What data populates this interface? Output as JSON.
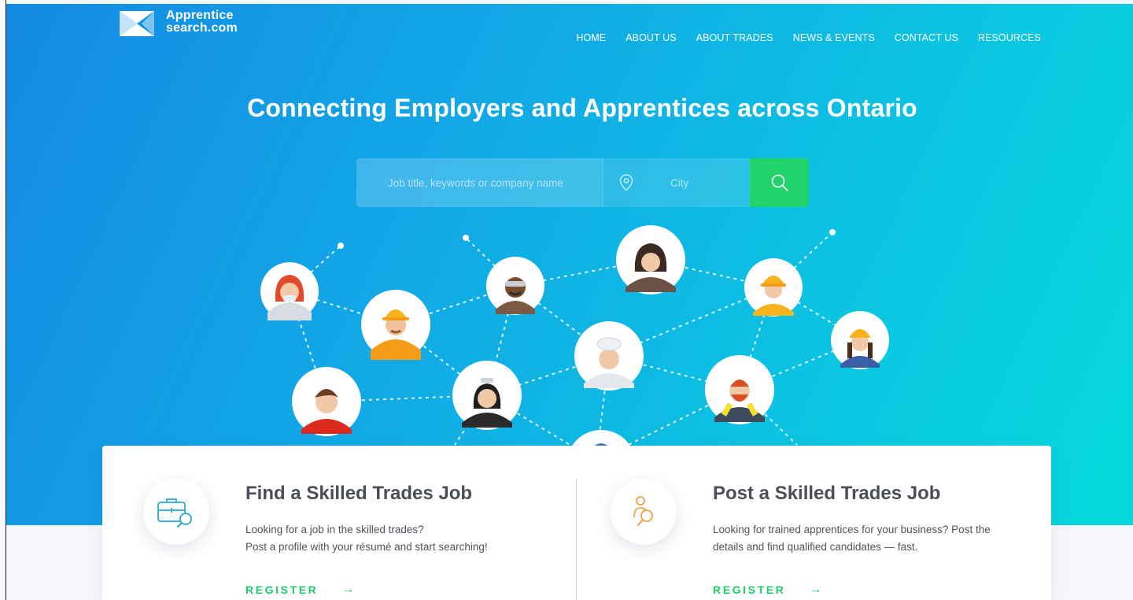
{
  "logo": {
    "line1": "Apprentice",
    "line2": "search.com"
  },
  "nav": {
    "home": "HOME",
    "about_us": "ABOUT US",
    "about_trades": "ABOUT TRADES",
    "news_events": "NEWS & EVENTS",
    "contact_us": "CONTACT US",
    "resources": "RESOURCES"
  },
  "hero": {
    "headline": "Connecting Employers and Apprentices across Ontario"
  },
  "search": {
    "keywords_placeholder": "Job title, keywords or company name",
    "city_placeholder": "City",
    "button_icon": "search-icon",
    "location_icon": "location-pin-icon"
  },
  "colors": {
    "accent_green": "#21d36b",
    "hero_blue": "#1489e3",
    "hero_cyan": "#06d9dc"
  },
  "find_job": {
    "title": "Find a Skilled Trades Job",
    "desc_line1": "Looking for a job in the skilled trades?",
    "desc_line2": "Post a profile with your résumé and start searching!",
    "cta": "REGISTER",
    "arrow": "→",
    "icon": "briefcase-search-icon"
  },
  "post_job": {
    "title": "Post a Skilled Trades Job",
    "desc_line1": "Looking for trained apprentices for your business? Post the",
    "desc_line2": "details and find qualified candidates — fast.",
    "cta": "REGISTER",
    "arrow": "→",
    "icon": "person-search-icon"
  }
}
